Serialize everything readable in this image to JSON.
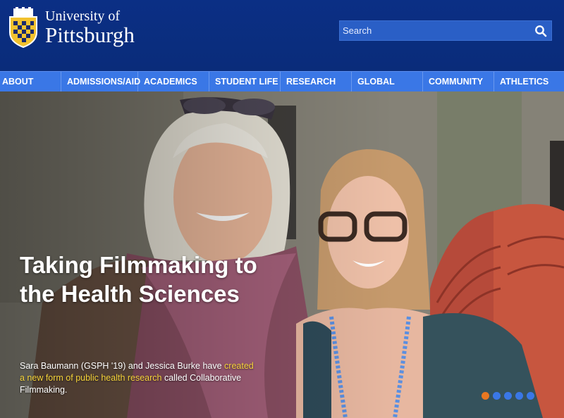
{
  "header": {
    "logo_line1": "University of",
    "logo_line2": "Pittsburgh"
  },
  "search": {
    "placeholder": "Search"
  },
  "nav": {
    "items": [
      "ABOUT",
      "ADMISSIONS/AID",
      "ACADEMICS",
      "STUDENT LIFE",
      "RESEARCH",
      "GLOBAL",
      "COMMUNITY",
      "ATHLETICS"
    ]
  },
  "hero": {
    "headline": "Taking Filmmaking to the Health Sciences",
    "caption_pre": "Sara Baumann (GSPH '19) and Jessica Burke have ",
    "caption_link": "created a new form of public health research",
    "caption_post": " called Collaborative Filmmaking.",
    "slides": 5,
    "active_slide": 1
  },
  "colors": {
    "header_bg": "#0b2f85",
    "nav_bg": "#3a77e6",
    "accent_gold": "#f5d33a",
    "dot_active": "#e87722"
  }
}
